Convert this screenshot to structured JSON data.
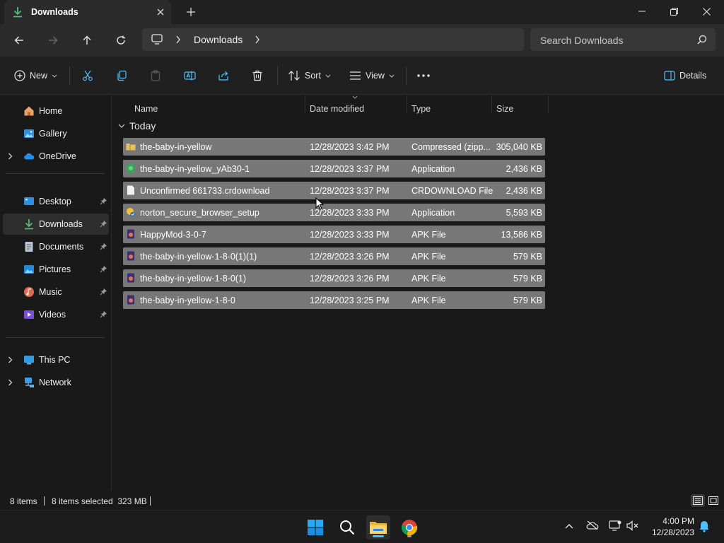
{
  "window": {
    "tab_title": "Downloads",
    "address_crumb": "Downloads",
    "search_placeholder": "Search Downloads"
  },
  "commands": {
    "new": "New",
    "sort": "Sort",
    "view": "View",
    "details": "Details"
  },
  "sidebar": {
    "items": [
      {
        "label": "Home",
        "icon": "home-icon"
      },
      {
        "label": "Gallery",
        "icon": "gallery-icon"
      },
      {
        "label": "OneDrive",
        "icon": "onedrive-icon"
      },
      {
        "label": "Desktop",
        "icon": "desktop-icon"
      },
      {
        "label": "Downloads",
        "icon": "downloads-icon"
      },
      {
        "label": "Documents",
        "icon": "documents-icon"
      },
      {
        "label": "Pictures",
        "icon": "pictures-icon"
      },
      {
        "label": "Music",
        "icon": "music-icon"
      },
      {
        "label": "Videos",
        "icon": "videos-icon"
      },
      {
        "label": "This PC",
        "icon": "this-pc-icon"
      },
      {
        "label": "Network",
        "icon": "network-icon"
      }
    ]
  },
  "columns": {
    "name": "Name",
    "date": "Date modified",
    "type": "Type",
    "size": "Size"
  },
  "group_label": "Today",
  "files": [
    {
      "name": "the-baby-in-yellow",
      "date": "12/28/2023 3:42 PM",
      "type": "Compressed (zipp...",
      "size": "305,040 KB",
      "icon": "zip-folder-icon"
    },
    {
      "name": "the-baby-in-yellow_yAb30-1",
      "date": "12/28/2023 3:37 PM",
      "type": "Application",
      "size": "2,436 KB",
      "icon": "application-icon"
    },
    {
      "name": "Unconfirmed 661733.crdownload",
      "date": "12/28/2023 3:37 PM",
      "type": "CRDOWNLOAD File",
      "size": "2,436 KB",
      "icon": "blank-file-icon"
    },
    {
      "name": "norton_secure_browser_setup",
      "date": "12/28/2023 3:33 PM",
      "type": "Application",
      "size": "5,593 KB",
      "icon": "installer-icon"
    },
    {
      "name": "HappyMod-3-0-7",
      "date": "12/28/2023 3:33 PM",
      "type": "APK File",
      "size": "13,586 KB",
      "icon": "apk-icon"
    },
    {
      "name": "the-baby-in-yellow-1-8-0(1)(1)",
      "date": "12/28/2023 3:26 PM",
      "type": "APK File",
      "size": "579 KB",
      "icon": "apk-icon"
    },
    {
      "name": "the-baby-in-yellow-1-8-0(1)",
      "date": "12/28/2023 3:26 PM",
      "type": "APK File",
      "size": "579 KB",
      "icon": "apk-icon"
    },
    {
      "name": "the-baby-in-yellow-1-8-0",
      "date": "12/28/2023 3:25 PM",
      "type": "APK File",
      "size": "579 KB",
      "icon": "apk-icon"
    }
  ],
  "status": {
    "item_count": "8 items",
    "selection": "8 items selected  323 MB"
  },
  "taskbar": {
    "time": "4:00 PM",
    "date": "12/28/2023"
  },
  "colors": {
    "selected_row": "#777777",
    "accent_blue": "#4cc2ff",
    "download_green": "#5fb878"
  }
}
